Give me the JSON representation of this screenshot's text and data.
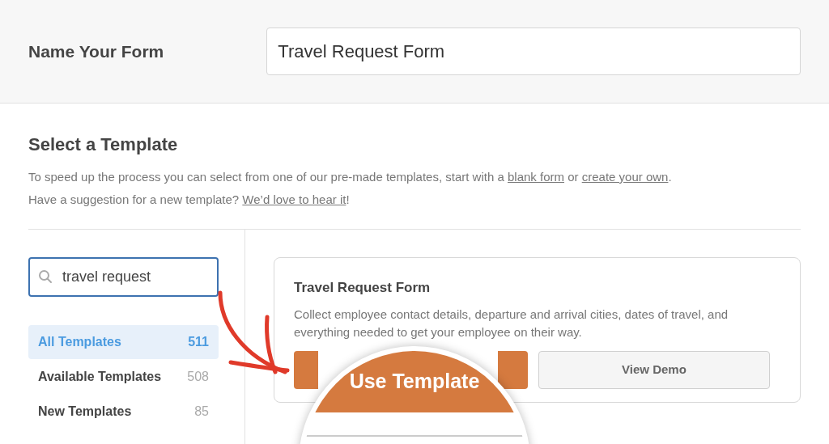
{
  "form_name": {
    "label": "Name Your Form",
    "value": "Travel Request Form"
  },
  "template_section": {
    "title": "Select a Template",
    "intro": [
      {
        "parts": [
          {
            "kind": "text",
            "text": "To speed up the process you can select from one of our pre-made templates, start with a "
          },
          {
            "kind": "link",
            "text": "blank form"
          },
          {
            "kind": "text",
            "text": " or "
          },
          {
            "kind": "link",
            "text": "create your own"
          },
          {
            "kind": "text",
            "text": "."
          }
        ]
      },
      {
        "parts": [
          {
            "kind": "text",
            "text": "Have a suggestion for a new template? "
          },
          {
            "kind": "link",
            "text": "We’d love to hear it"
          },
          {
            "kind": "text",
            "text": "!"
          }
        ]
      }
    ]
  },
  "sidebar": {
    "search": {
      "value": "travel request"
    },
    "categories": [
      {
        "label": "All Templates",
        "count": "511",
        "selected": true
      },
      {
        "label": "Available Templates",
        "count": "508",
        "selected": false
      },
      {
        "label": "New Templates",
        "count": "85",
        "selected": false
      }
    ]
  },
  "template_card": {
    "title": "Travel Request Form",
    "description": "Collect employee contact details, departure and arrival cities, dates of travel, and everything needed to get your employee on their way.",
    "buttons": [
      {
        "kind": "primary",
        "label": "Use Template"
      },
      {
        "kind": "secondary",
        "label": "View Demo"
      }
    ]
  }
}
